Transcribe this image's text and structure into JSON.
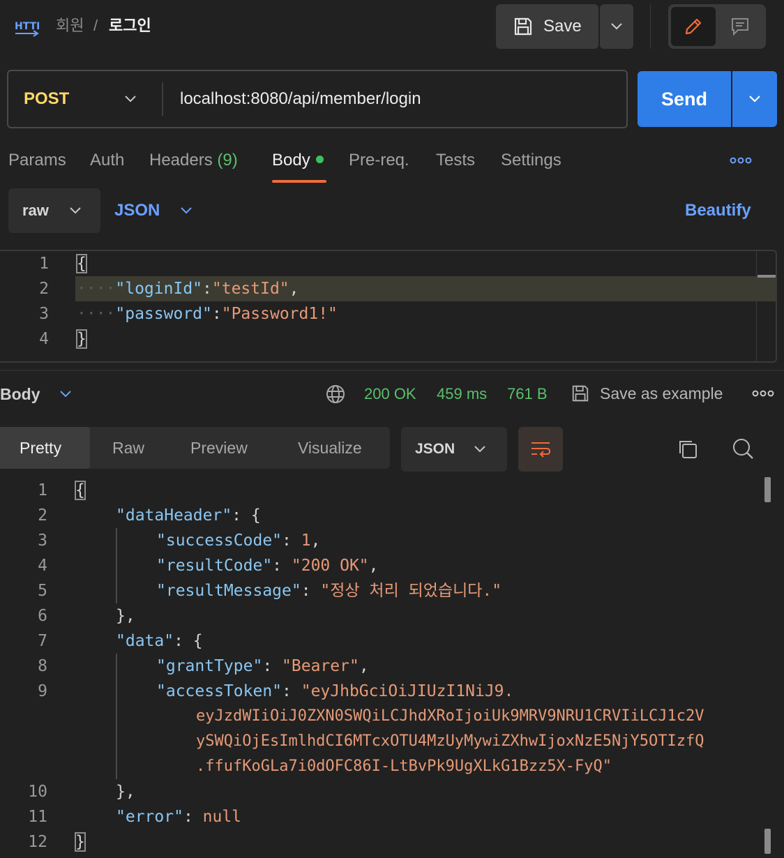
{
  "breadcrumb": {
    "protocol_icon": "http-icon",
    "parent": "회원",
    "separator": "/",
    "current": "로그인"
  },
  "toolbar": {
    "save_label": "Save",
    "save_icon": "save-icon",
    "active_mode": "edit"
  },
  "request": {
    "method": "POST",
    "url": "localhost:8080/api/member/login",
    "send_label": "Send"
  },
  "request_tabs": [
    {
      "label": "Params"
    },
    {
      "label": "Auth"
    },
    {
      "label": "Headers",
      "count": "(9)"
    },
    {
      "label": "Body",
      "active": true
    },
    {
      "label": "Pre-req."
    },
    {
      "label": "Tests"
    },
    {
      "label": "Settings"
    }
  ],
  "body_options": {
    "mode": "raw",
    "language": "JSON",
    "beautify_label": "Beautify"
  },
  "request_body": {
    "line_numbers": [
      "1",
      "2",
      "3",
      "4"
    ],
    "open_brace": "{",
    "close_brace": "}",
    "key1": "\"loginId\"",
    "val1": "\"testId\"",
    "key2": "\"password\"",
    "val2": "\"Password1!\""
  },
  "response_meta": {
    "section_label": "Body",
    "status": "200 OK",
    "time": "459 ms",
    "size": "761 B",
    "save_example_label": "Save as example"
  },
  "response_view_tabs": [
    {
      "label": "Pretty",
      "active": true
    },
    {
      "label": "Raw"
    },
    {
      "label": "Preview"
    },
    {
      "label": "Visualize"
    }
  ],
  "response_format": "JSON",
  "response_body": {
    "line_numbers": [
      "1",
      "2",
      "3",
      "4",
      "5",
      "6",
      "7",
      "8",
      "9",
      "10",
      "11",
      "12"
    ],
    "dataHeader_key": "\"dataHeader\"",
    "successCode_key": "\"successCode\"",
    "successCode_val": "1",
    "resultCode_key": "\"resultCode\"",
    "resultCode_val": "\"200 OK\"",
    "resultMessage_key": "\"resultMessage\"",
    "resultMessage_val": "\"정상 처리 되었습니다.\"",
    "data_key": "\"data\"",
    "grantType_key": "\"grantType\"",
    "grantType_val": "\"Bearer\"",
    "accessToken_key": "\"accessToken\"",
    "accessToken_val_1": "\"eyJhbGciOiJIUzI1NiJ9.",
    "accessToken_val_2": "eyJzdWIiOiJ0ZXN0SWQiLCJhdXRoIjoiUk9MRV9NRU1CRVIiLCJ1c2V",
    "accessToken_val_3": "ySWQiOjEsImlhdCI6MTcxOTU4MzUyMywiZXhwIjoxNzE5NjY5OTIzfQ",
    "accessToken_val_4": ".ffufKoGLa7i0dOFC86I-LtBvPk9UgXLkG1Bzz5X-FyQ\"",
    "error_key": "\"error\"",
    "error_val": "null"
  },
  "colors": {
    "method": "#ffd966",
    "send": "#2f7ee8",
    "link": "#6aa1ff",
    "status_ok": "#5cbf6c",
    "json_key": "#8ac6f2",
    "json_string": "#e69a77",
    "active_tab_underline": "#f06c3a"
  }
}
